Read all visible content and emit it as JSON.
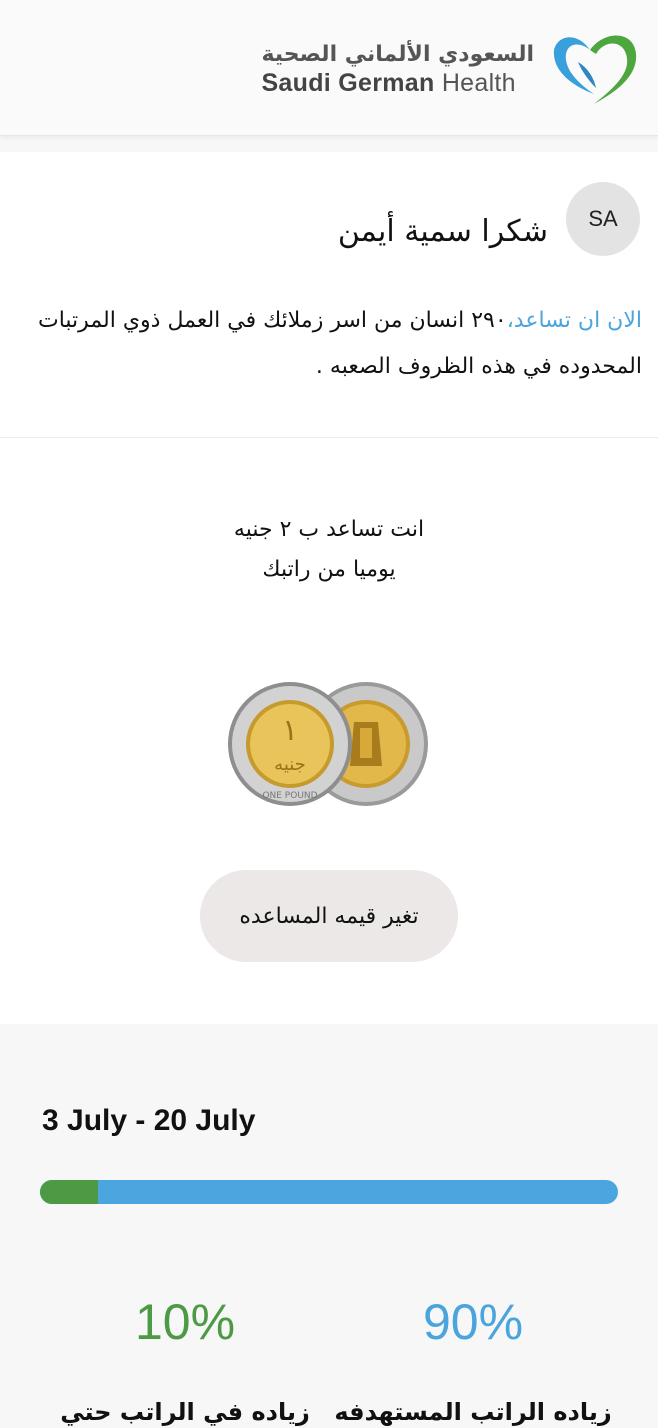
{
  "header": {
    "logo_arabic": "السعودي الألماني الصحية",
    "logo_english_bold": "Saudi German",
    "logo_english_light": "Health",
    "logo_icon": "heart-logo-icon",
    "colors": {
      "logo_blue": "#3aa0dc",
      "logo_green": "#4ea63f"
    }
  },
  "thanks": {
    "avatar_initials": "SA",
    "title": "شكرا سمية أيمن",
    "body_highlight": "الان ان تساعد،",
    "body_rest": "٢٩٠ انسان من اسر زملائك في العمل ذوي المرتبات المحدوده في هذه الظروف الصعبه ."
  },
  "contribution": {
    "line1": "انت تساعد ب ٢ جنيه",
    "line2": "يوميا من راتبك",
    "coins_icon": "egyptian-pound-coins-icon",
    "change_button": "تغير قيمه المساعده"
  },
  "progress": {
    "date_range": "3 July - 20 July",
    "achieved_fraction": 0.1,
    "achieved_percent": "10%",
    "achieved_label": "زياده في الراتب حتي",
    "target_percent": "90%",
    "target_label": "زياده الراتب المستهدفه",
    "colors": {
      "achieved": "#4d9a45",
      "target": "#4aa4dd"
    }
  }
}
